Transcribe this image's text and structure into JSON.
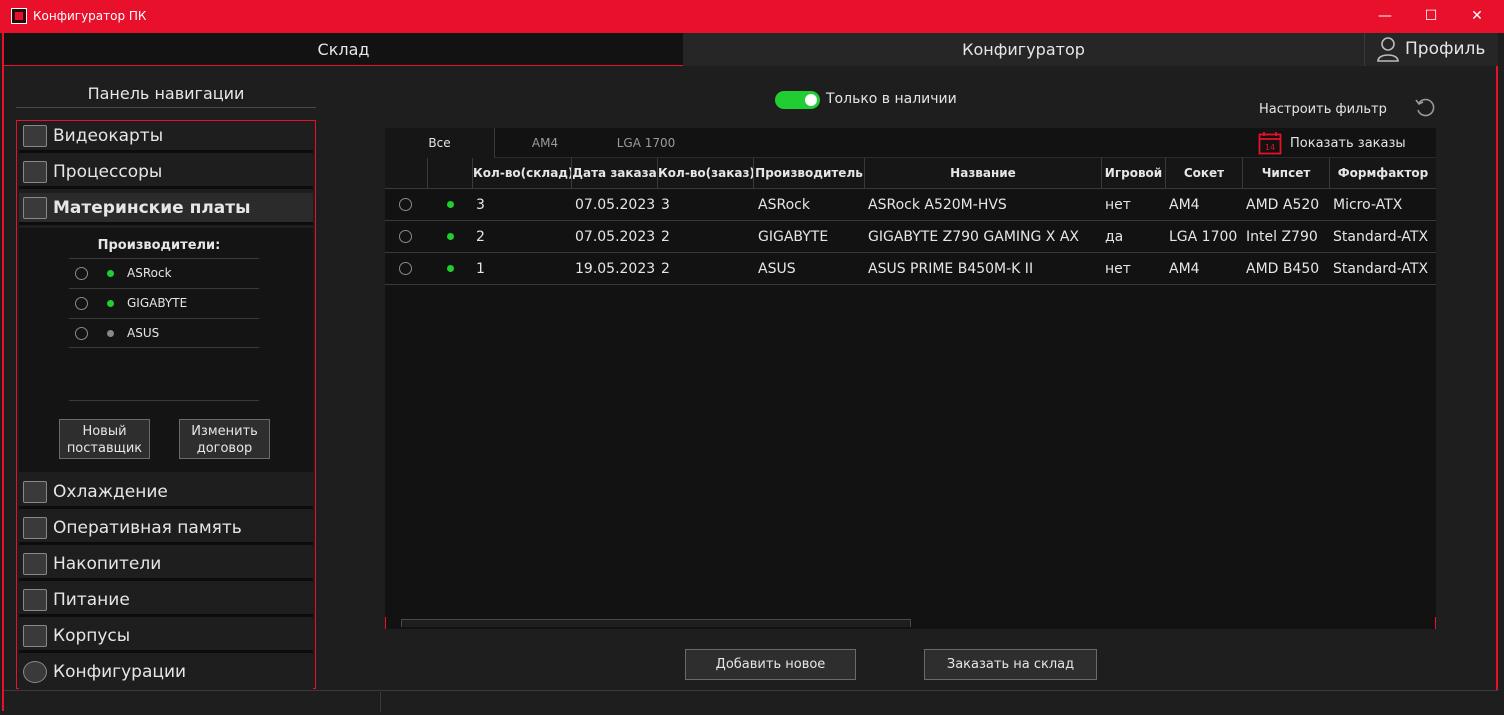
{
  "window": {
    "title": "Конфигуратор ПК",
    "minimize": "—",
    "maximize": "☐",
    "close": "✕"
  },
  "top_tabs": {
    "sklad": "Склад",
    "konfigurator": "Конфигуратор",
    "profile": "Профиль"
  },
  "nav": {
    "title": "Панель навигации",
    "items": [
      {
        "label": "Видеокарты",
        "icon": "gpu-icon"
      },
      {
        "label": "Процессоры",
        "icon": "cpu-icon"
      },
      {
        "label": "Материнские платы",
        "icon": "motherboard-icon"
      },
      {
        "label": "Охлаждение",
        "icon": "cooler-icon"
      },
      {
        "label": "Оперативная память",
        "icon": "ram-icon"
      },
      {
        "label": "Накопители",
        "icon": "storage-icon"
      },
      {
        "label": "Питание",
        "icon": "psu-icon"
      },
      {
        "label": "Корпусы",
        "icon": "case-icon"
      },
      {
        "label": "Конфигурации",
        "icon": "config-gear-icon"
      }
    ],
    "vendors_title": "Производители:",
    "vendors": [
      {
        "name": "ASRock",
        "status": "green"
      },
      {
        "name": "GIGABYTE",
        "status": "green"
      },
      {
        "name": "ASUS",
        "status": "gray"
      }
    ],
    "new_supplier": [
      "Новый",
      "поставщик"
    ],
    "edit_contract": [
      "Изменить",
      "договор"
    ]
  },
  "filters": {
    "in_stock_label": "Только в наличии",
    "in_stock_on": true,
    "configure_filter": "Настроить фильтр",
    "tabs": [
      "Все",
      "AM4",
      "LGA 1700"
    ],
    "show_orders": "Показать заказы"
  },
  "table": {
    "columns": [
      "",
      "",
      "Кол-во(склад)",
      "Дата заказа",
      "Кол-во(заказ)",
      "Производитель",
      "Название",
      "Игровой",
      "Сокет",
      "Чипсет",
      "Формфактор"
    ],
    "rows": [
      {
        "stock": "3",
        "order_date": "07.05.2023",
        "order_qty": "3",
        "vendor": "ASRock",
        "name": "ASRock A520M-HVS",
        "gaming": "нет",
        "socket": "AM4",
        "chipset": "AMD A520",
        "form": "Micro-ATX"
      },
      {
        "stock": "2",
        "order_date": "07.05.2023",
        "order_qty": "2",
        "vendor": "GIGABYTE",
        "name": "GIGABYTE Z790 GAMING X AX",
        "gaming": "да",
        "socket": "LGA 1700",
        "chipset": "Intel Z790",
        "form": "Standard-ATX"
      },
      {
        "stock": "1",
        "order_date": "19.05.2023",
        "order_qty": "2",
        "vendor": "ASUS",
        "name": "ASUS PRIME B450M-K II",
        "gaming": "нет",
        "socket": "AM4",
        "chipset": "AMD B450",
        "form": "Standard-ATX"
      }
    ]
  },
  "actions": {
    "add_new": "Добавить новое",
    "order_to_stock": "Заказать на склад"
  },
  "colors": {
    "accent": "#e8102a",
    "status_green": "#22cc33",
    "background": "#1e1e1e"
  }
}
